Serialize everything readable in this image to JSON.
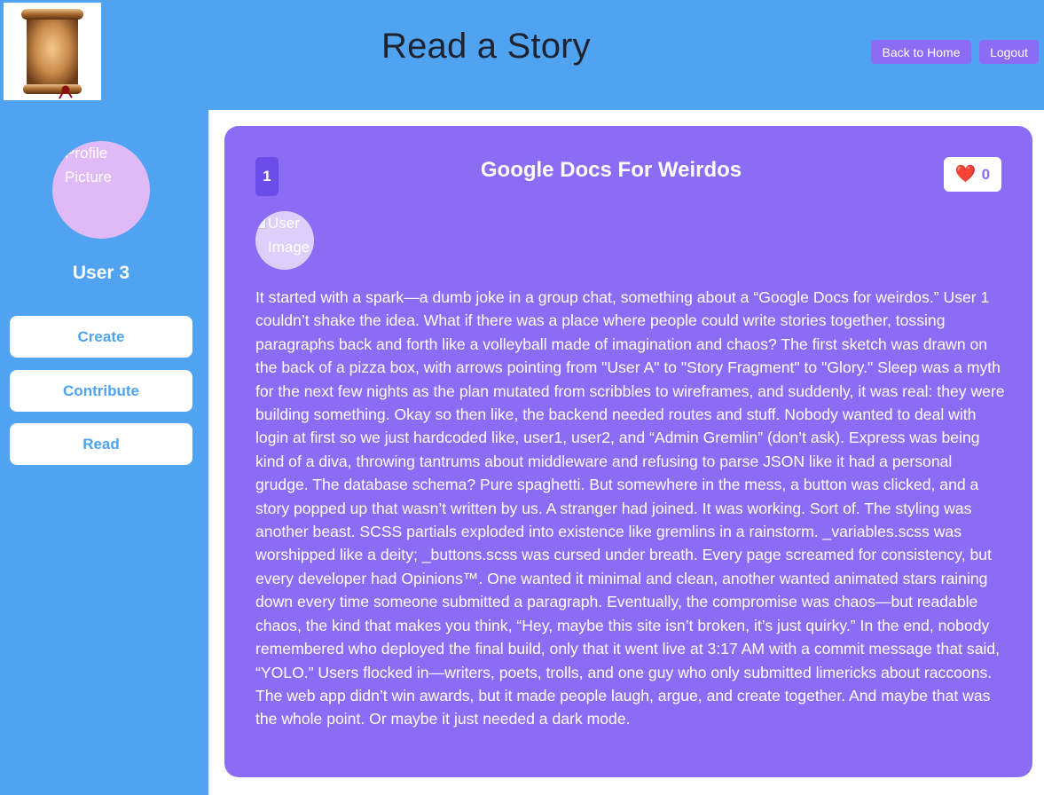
{
  "header": {
    "title": "Read a Story",
    "back_home_label": "Back to Home",
    "logout_label": "Logout",
    "logo_icon": "scroll-icon"
  },
  "sidebar": {
    "profile_alt": "Profile Picture",
    "username": "User 3",
    "nav": {
      "create": "Create",
      "contribute": "Contribute",
      "read": "Read"
    }
  },
  "story": {
    "number": "1",
    "title": "Google Docs For Weirdos",
    "likes": "0",
    "like_icon": "heart-icon",
    "user_image_alt": "User Image",
    "body": "It started with a spark—a dumb joke in a group chat, something about a “Google Docs for weirdos.” User 1 couldn’t shake the idea. What if there was a place where people could write stories together, tossing paragraphs back and forth like a volleyball made of imagination and chaos? The first sketch was drawn on the back of a pizza box, with arrows pointing from \"User A\" to \"Story Fragment\" to \"Glory.\" Sleep was a myth for the next few nights as the plan mutated from scribbles to wireframes, and suddenly, it was real: they were building something. Okay so then like, the backend needed routes and stuff. Nobody wanted to deal with login at first so we just hardcoded like, user1, user2, and “Admin Gremlin” (don’t ask). Express was being kind of a diva, throwing tantrums about middleware and refusing to parse JSON like it had a personal grudge. The database schema? Pure spaghetti. But somewhere in the mess, a button was clicked, and a story popped up that wasn’t written by us. A stranger had joined. It was working. Sort of. The styling was another beast. SCSS partials exploded into existence like gremlins in a rainstorm. _variables.scss was worshipped like a deity; _buttons.scss was cursed under breath. Every page screamed for consistency, but every developer had Opinions™. One wanted it minimal and clean, another wanted animated stars raining down every time someone submitted a paragraph. Eventually, the compromise was chaos—but readable chaos, the kind that makes you think, “Hey, maybe this site isn’t broken, it’s just quirky.” In the end, nobody remembered who deployed the final build, only that it went live at 3:17 AM with a commit message that said, “YOLO.” Users flocked in—writers, poets, trolls, and one guy who only submitted limericks about raccoons. The web app didn’t win awards, but it made people laugh, argue, and create together. And maybe that was the whole point. Or maybe it just needed a dark mode."
  },
  "colors": {
    "header_bg": "#4fa3f1",
    "sidebar_bg": "#4fa3f1",
    "card_bg": "#8b6cf5",
    "accent": "#6a4ce8",
    "heart": "#e0293a"
  }
}
